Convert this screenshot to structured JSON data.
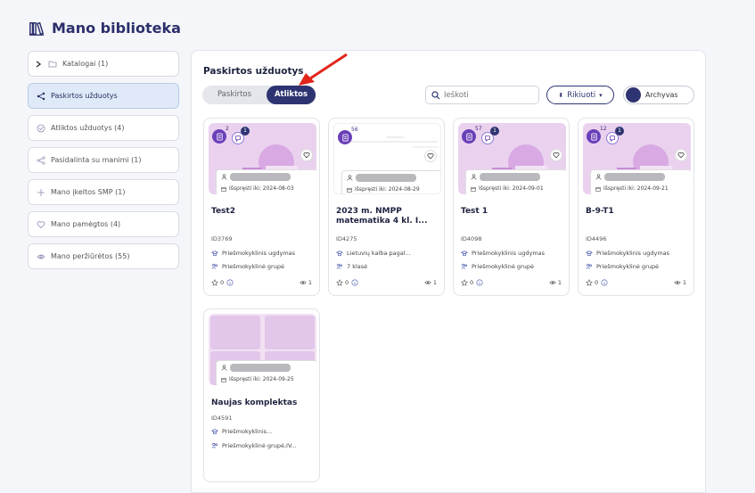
{
  "page": {
    "title": "Mano biblioteka"
  },
  "sidebar": {
    "items": [
      {
        "label": "Katalogai  (1)"
      },
      {
        "label": "Paskirtos užduotys"
      },
      {
        "label": "Atliktos užduotys  (4)"
      },
      {
        "label": "Pasidalinta su manimi  (1)"
      },
      {
        "label": "Mano įkeltos SMP  (1)"
      },
      {
        "label": "Mano pamėgtos  (4)"
      },
      {
        "label": "Mano peržiūrėtos  (55)"
      }
    ]
  },
  "main": {
    "title": "Paskirtos užduotys",
    "toggle": {
      "option1": "Paskirtos",
      "option2": "Atliktos",
      "selected": "Atliktos"
    },
    "search": {
      "placeholder": "Ieškoti",
      "value": ""
    },
    "sort_label": "Rikiuoti",
    "archive_label": "Archyvas",
    "colors": {
      "primary": "#2e3471",
      "accent_red": "#e1251b",
      "card_thumb": "#ead2ef"
    }
  },
  "cards": [
    {
      "doc_count": "2",
      "chat_count": "1",
      "deadline": "Išspręsti iki: 2024-08-03",
      "title": "Test2",
      "id": "ID3769",
      "meta1": "Priešmokyklinis ugdymas",
      "meta2": "Priešmokyklinė grupė",
      "rating": "0",
      "views": "1"
    },
    {
      "doc_count": "56",
      "chat_count": "",
      "deadline": "Išspręsti iki: 2024-08-29",
      "title": "2023 m. NMPP matematika 4 kl. I...",
      "id": "ID4275",
      "meta1": "Lietuvių kalba pagal...",
      "meta2": "7 klasė",
      "rating": "0",
      "views": "1"
    },
    {
      "doc_count": "57",
      "chat_count": "1",
      "deadline": "Išspręsti iki: 2024-09-01",
      "title": "Test 1",
      "id": "ID4098",
      "meta1": "Priešmokyklinis ugdymas",
      "meta2": "Priešmokyklinė grupė",
      "rating": "0",
      "views": "1"
    },
    {
      "doc_count": "12",
      "chat_count": "1",
      "deadline": "Išspręsti iki: 2024-09-21",
      "title": "B-9-T1",
      "id": "ID4496",
      "meta1": "Priešmokyklinis ugdymas",
      "meta2": "Priešmokyklinė grupė",
      "rating": "0",
      "views": "1"
    },
    {
      "deadline": "Išspręsti iki: 2024-09-25",
      "title": "Naujas komplektas",
      "id": "ID4591",
      "meta1": "Priešmokyklinis...",
      "meta2": "Priešmokyklinė grupė,IV..."
    }
  ]
}
